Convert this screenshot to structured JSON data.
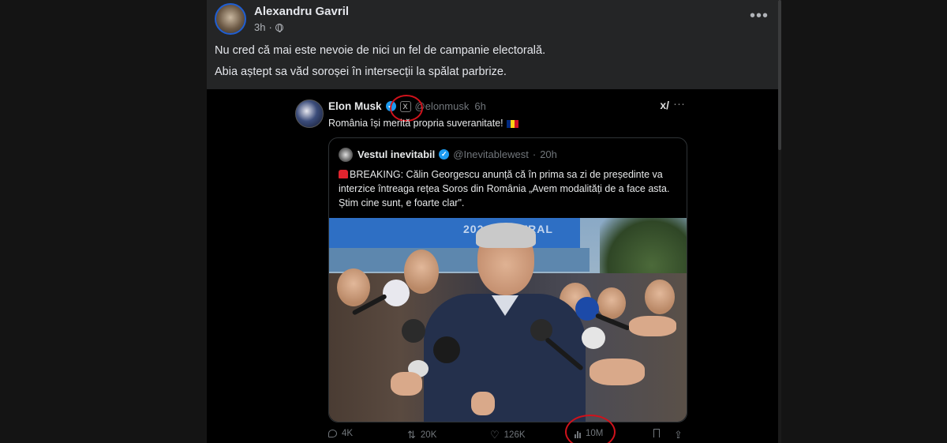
{
  "post": {
    "author": "Alexandru Gavril",
    "time": "3h",
    "separator": "·",
    "more_label": "•••",
    "line1": "Nu cred că mai este nevoie de nici un fel de campanie electorală.",
    "line2": "Abia aștept sa văd soroșei în intersecții la spălat parbrize."
  },
  "tweet": {
    "name": "Elon Musk",
    "x_badge": "X",
    "handle": "@elonmusk",
    "time": "6h",
    "text": "România își merită propria suveranitate!",
    "grok_label": "x/",
    "more_label": "···"
  },
  "quote": {
    "name": "Vestul inevitabil",
    "handle": "@Inevitablewest",
    "time": "20h",
    "text": "BREAKING: Călin Georgescu anunță că în prima sa zi de președinte va interzice întreaga rețea Soros din România „Avem modalități de a face asta. Știm cine sunt, e foarte clar\".",
    "photo_banner": "2024 CENTRAL"
  },
  "actions": {
    "replies": "4K",
    "reposts": "20K",
    "likes": "126K",
    "views": "10M"
  },
  "colors": {
    "annotation_circle": "#d0121b",
    "verified": "#1d9bf0",
    "page_bg": "#141414",
    "post_bg": "#242526"
  }
}
